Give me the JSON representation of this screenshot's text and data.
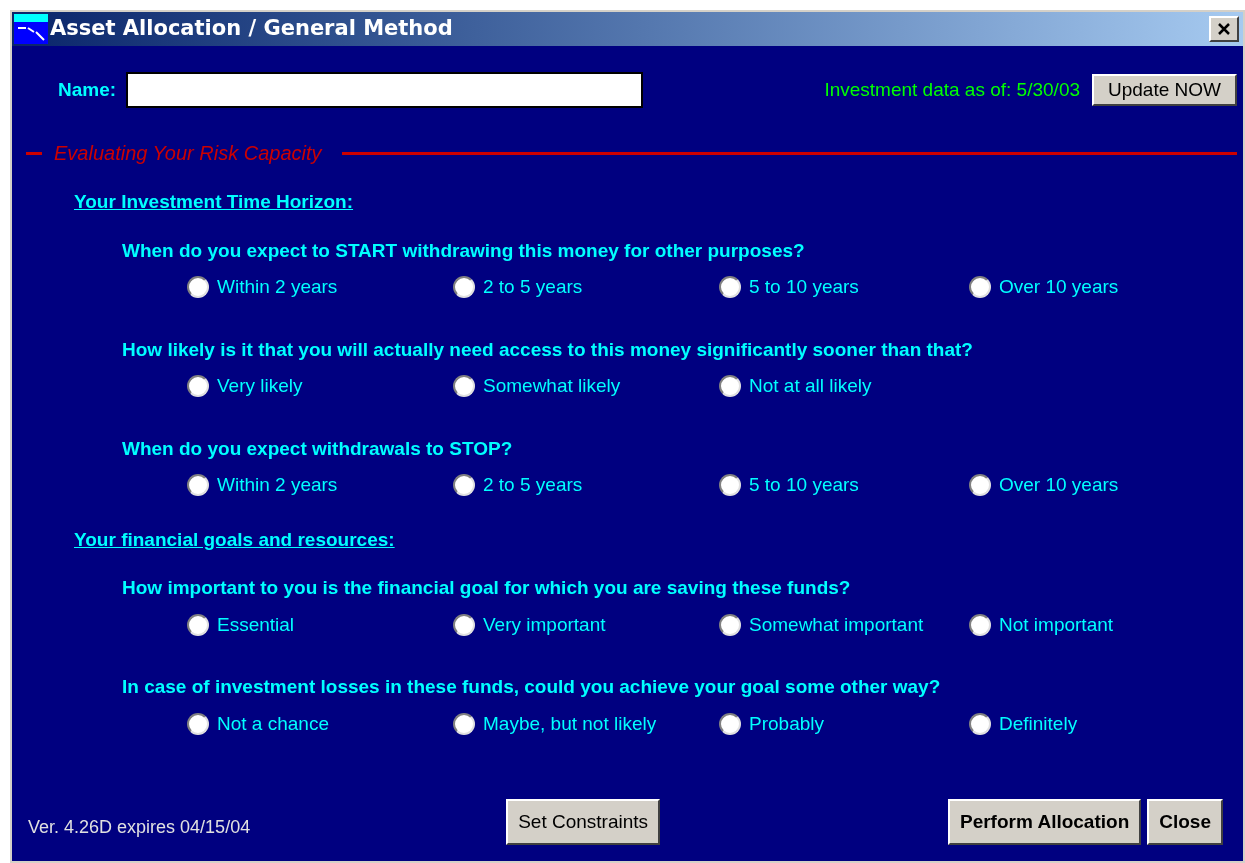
{
  "window": {
    "title": "Asset Allocation / General Method"
  },
  "name_field": {
    "label": "Name:"
  },
  "data_date": "Investment data as of: 5/30/03",
  "update_button": "Update NOW",
  "section_title": "Evaluating Your Risk Capacity",
  "groups": [
    {
      "heading": "Your Investment Time Horizon:",
      "questions": [
        {
          "text": "When do you expect to START withdrawing this money for other purposes?",
          "options": [
            {
              "label": "Within 2 years",
              "selected": false
            },
            {
              "label": "2 to 5 years",
              "selected": false
            },
            {
              "label": "5 to 10 years",
              "selected": false
            },
            {
              "label": "Over 10 years",
              "selected": false
            }
          ]
        },
        {
          "text": "How likely is it that you will actually need access to this money significantly sooner than that?",
          "options": [
            {
              "label": "Very likely",
              "selected": false
            },
            {
              "label": "Somewhat likely",
              "selected": false
            },
            {
              "label": "Not at all likely",
              "selected": false
            }
          ]
        },
        {
          "text": "When do you expect withdrawals to STOP?",
          "options": [
            {
              "label": "Within 2 years",
              "selected": false
            },
            {
              "label": "2 to 5 years",
              "selected": false
            },
            {
              "label": "5 to 10 years",
              "selected": false
            },
            {
              "label": "Over 10 years",
              "selected": false
            }
          ]
        }
      ]
    },
    {
      "heading": "Your financial goals and resources:",
      "questions": [
        {
          "text": "How important to you is the financial goal for which you are saving these funds?",
          "options": [
            {
              "label": "Essential",
              "selected": false
            },
            {
              "label": "Very important",
              "selected": false
            },
            {
              "label": "Somewhat important",
              "selected": false
            },
            {
              "label": "Not important",
              "selected": false
            }
          ]
        },
        {
          "text": "In case of investment losses in these funds, could you achieve your goal some other way?",
          "options": [
            {
              "label": "Not a chance",
              "selected": false
            },
            {
              "label": "Maybe, but not likely",
              "selected": false
            },
            {
              "label": "Probably",
              "selected": false
            },
            {
              "label": "Definitely",
              "selected": false
            }
          ]
        }
      ]
    }
  ],
  "version": "Ver. 4.26D expires 04/15/04",
  "buttons": [
    {
      "label": "Set Constraints",
      "kind": "plain"
    },
    {
      "label": "Perform Allocation",
      "kind": "bold"
    },
    {
      "label": "Close",
      "kind": "bold"
    }
  ]
}
